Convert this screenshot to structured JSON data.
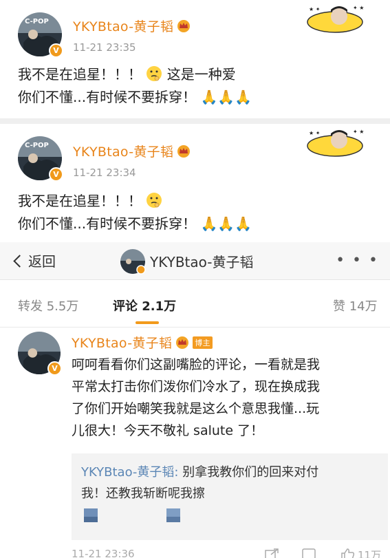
{
  "post1": {
    "username": "YKYBtao-黄子韬",
    "time": "11-21 23:35",
    "line1": "我不是在追星！！！",
    "line1b": "这是一种爱",
    "line2": "你们不懂...有时候不要拆穿！"
  },
  "post2": {
    "username": "YKYBtao-黄子韬",
    "time": "11-21 23:34",
    "line1": "我不是在追星！！！",
    "line2": "你们不懂...有时候不要拆穿！"
  },
  "nav": {
    "back_label": "返回",
    "title": "YKYBtao-黄子韬",
    "more": "• • •"
  },
  "tabs": {
    "repost": "转发 5.5万",
    "comment": "评论 2.1万",
    "like": "赞 14万"
  },
  "comment": {
    "username": "YKYBtao-黄子韬",
    "host_badge": "博主",
    "lines": [
      "呵呵看看你们这副嘴脸的评论，一看就是我",
      "平常太打击你们泼你们冷水了，现在换成我",
      "了你们开始嘲笑我就是这么个意思我懂...玩",
      "儿很大！今天不敬礼 salute 了！"
    ],
    "quote_user": "YKYBtao-黄子韬:",
    "quote_text1": " 别拿我教你们的回来对付",
    "quote_text2": "我！还教我斩断呢我擦",
    "time": "11-21 23:36",
    "likes": "11万"
  },
  "colors": {
    "username": "#e8841a",
    "accent": "#f29a1c",
    "quote_user": "#5b86b5"
  }
}
